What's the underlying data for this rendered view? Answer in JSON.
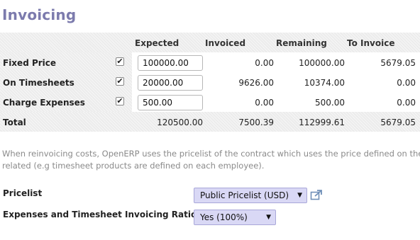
{
  "page": {
    "title": "Invoicing"
  },
  "table": {
    "headers": {
      "expected": "Expected",
      "invoiced": "Invoiced",
      "remaining": "Remaining",
      "to_invoice": "To Invoice"
    },
    "rows": [
      {
        "label": "Fixed Price",
        "checked": true,
        "expected": "100000.00",
        "invoiced": "0.00",
        "remaining": "100000.00",
        "to_invoice": "5679.05"
      },
      {
        "label": "On Timesheets",
        "checked": true,
        "expected": "20000.00",
        "invoiced": "9626.00",
        "remaining": "10374.00",
        "to_invoice": "0.00"
      },
      {
        "label": "Charge Expenses",
        "checked": true,
        "expected": "500.00",
        "invoiced": "0.00",
        "remaining": "500.00",
        "to_invoice": "0.00"
      }
    ],
    "total": {
      "label": "Total",
      "expected": "120500.00",
      "invoiced": "7500.39",
      "remaining": "112999.61",
      "to_invoice": "5679.05"
    }
  },
  "note": {
    "line1": "When reinvoicing costs, OpenERP uses the pricelist of the contract which uses the price defined on the",
    "line2": "related (e.g timesheet products are defined on each employee)."
  },
  "pricelist": {
    "label": "Pricelist",
    "value": "Public Pricelist (USD)",
    "open_icon": "external-link-icon"
  },
  "ratio": {
    "label": "Expenses and Timesheet Invoicing Ratio",
    "value": "Yes (100%)"
  },
  "colors": {
    "title": "#7c7bad",
    "select_bg": "#d9d8f5",
    "note": "#8a8a8a"
  }
}
